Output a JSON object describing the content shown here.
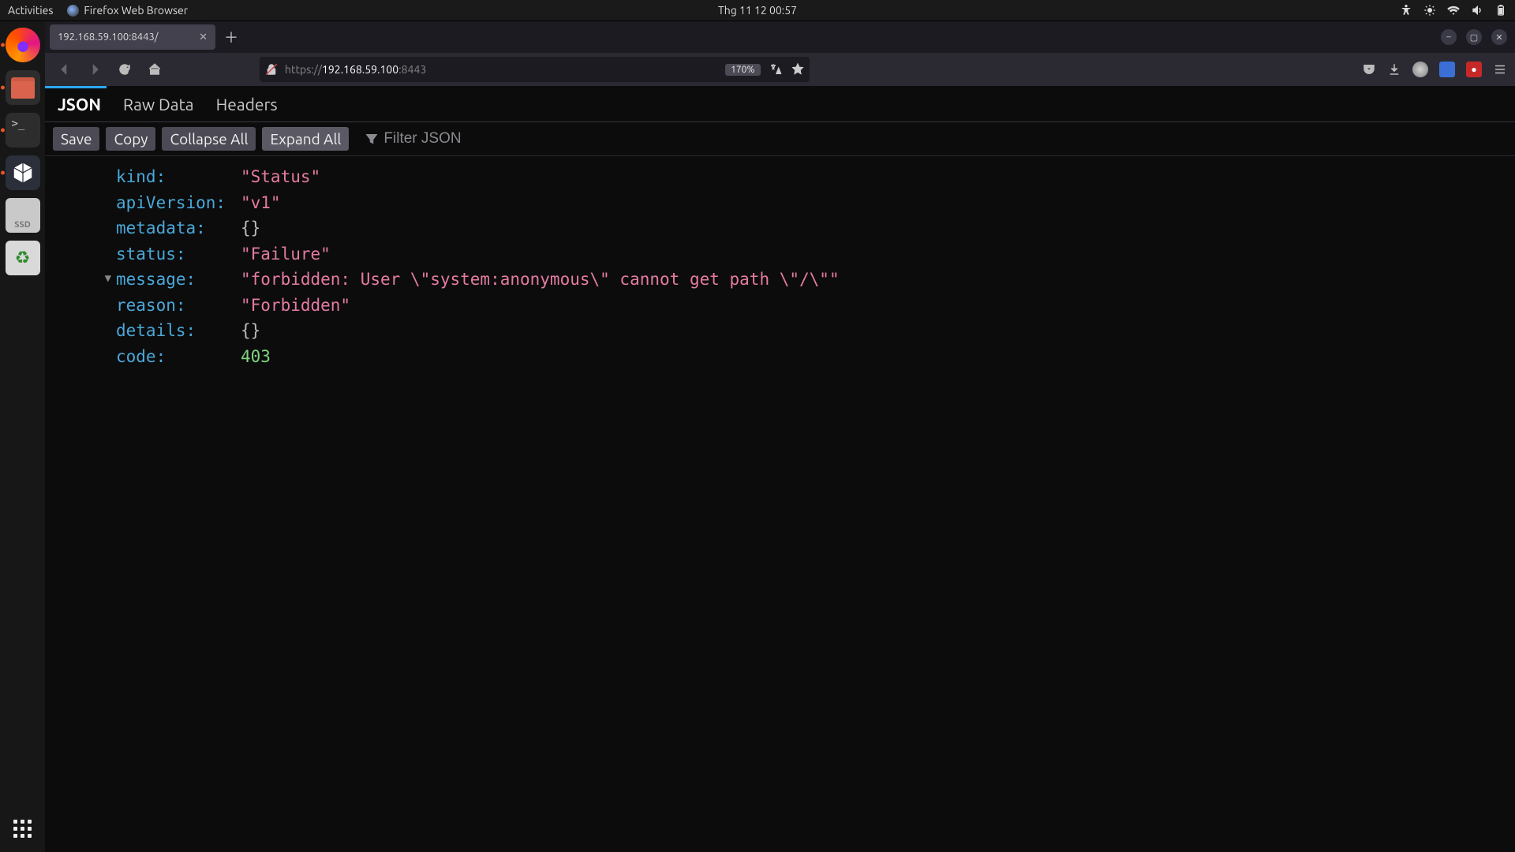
{
  "topbar": {
    "activities": "Activities",
    "app_name": "Firefox Web Browser",
    "clock": "Thg 11 12  00:57"
  },
  "dock": {
    "ssd_label": "SSD"
  },
  "browser": {
    "tab_title": "192.168.59.100:8443/",
    "url_scheme": "https://",
    "url_host": "192.168.59.100",
    "url_port": ":8443",
    "zoom": "170%"
  },
  "json_viewer": {
    "tabs": {
      "json": "JSON",
      "raw": "Raw Data",
      "headers": "Headers"
    },
    "toolbar": {
      "save": "Save",
      "copy": "Copy",
      "collapse": "Collapse All",
      "expand": "Expand All",
      "filter_placeholder": "Filter JSON"
    },
    "keys": {
      "kind": "kind:",
      "apiVersion": "apiVersion:",
      "metadata": "metadata:",
      "status": "status:",
      "message": "message:",
      "reason": "reason:",
      "details": "details:",
      "code": "code:"
    },
    "vals": {
      "kind": "\"Status\"",
      "apiVersion": "\"v1\"",
      "metadata": "{}",
      "status": "\"Failure\"",
      "message": "\"forbidden: User \\\"system:anonymous\\\" cannot get path \\\"/\\\"\"",
      "reason": "\"Forbidden\"",
      "details": "{}",
      "code": "403"
    }
  }
}
